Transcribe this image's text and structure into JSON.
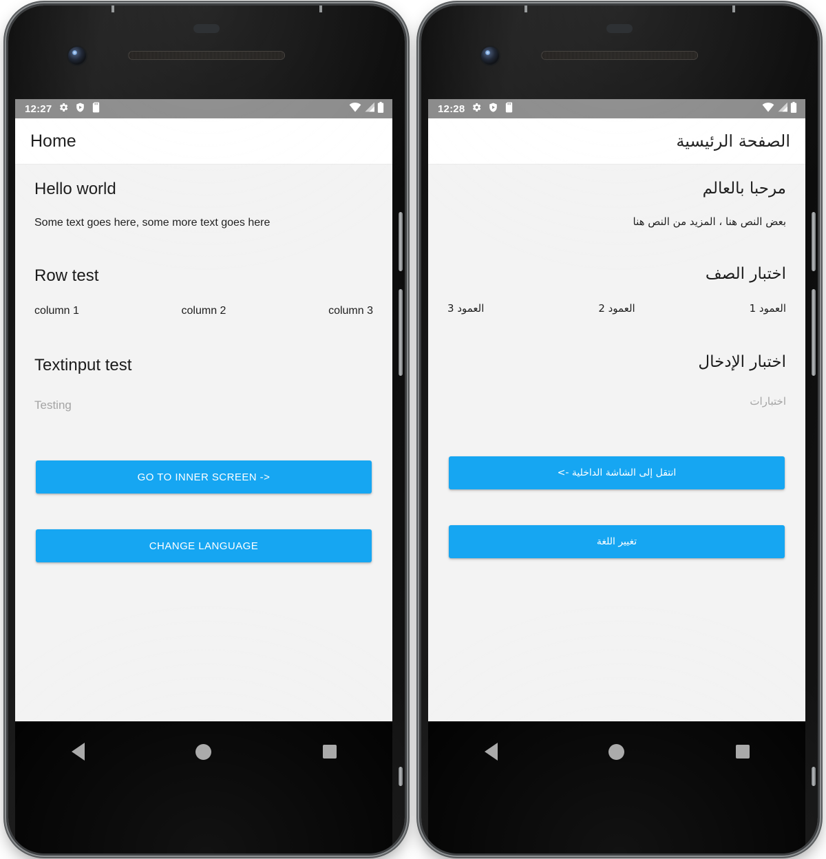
{
  "phones": [
    {
      "id": "phone-ltr-english",
      "direction": "ltr",
      "language": "English",
      "status_bar": {
        "time": "12:27",
        "icons": [
          "gear-icon",
          "shield-play-protect-icon",
          "sd-card-icon"
        ],
        "right_icons": [
          "wifi-icon",
          "cell-signal-icon",
          "battery-icon"
        ]
      },
      "app_bar": {
        "title": "Home"
      },
      "content": {
        "hello_heading": "Hello world",
        "hello_body": "Some text goes here, some more text goes here",
        "row_heading": "Row test",
        "row_cells": [
          "column 1",
          "column 2",
          "column 3"
        ],
        "input_heading": "Textinput test",
        "input_value": "",
        "input_placeholder": "Testing",
        "primary_button": "GO TO INNER SCREEN ->",
        "secondary_button": "CHANGE LANGUAGE"
      },
      "nav_bar": [
        "back-icon",
        "home-icon",
        "recent-apps-icon"
      ]
    },
    {
      "id": "phone-rtl-arabic",
      "direction": "rtl",
      "language": "Arabic",
      "status_bar": {
        "time": "12:28",
        "icons": [
          "gear-icon",
          "shield-play-protect-icon",
          "sd-card-icon"
        ],
        "right_icons": [
          "wifi-icon",
          "cell-signal-icon",
          "battery-icon"
        ]
      },
      "app_bar": {
        "title": "الصفحة الرئيسية"
      },
      "content": {
        "hello_heading": "مرحبا بالعالم",
        "hello_body": "بعض النص هنا ، المزيد من النص هنا",
        "row_heading": "اختبار الصف",
        "row_cells": [
          "العمود 1",
          "العمود 2",
          "العمود 3"
        ],
        "input_heading": "اختبار الإدخال",
        "input_value": "",
        "input_placeholder": "اختبارات",
        "primary_button": "انتقل إلى الشاشة الداخلية ->",
        "secondary_button": "تغيير اللغة"
      },
      "nav_bar": [
        "back-icon",
        "home-icon",
        "recent-apps-icon"
      ]
    }
  ],
  "theme": {
    "accent_blue": "#16a6f2",
    "status_bar_gray": "#8a8a8a",
    "content_bg": "#f3f3f3",
    "app_bar_bg": "#ffffff",
    "nav_bar_bg": "#000000",
    "nav_icon_gray": "#a8a8a8",
    "text_primary": "#1d1d1d",
    "placeholder_gray": "#a4a4a4"
  }
}
